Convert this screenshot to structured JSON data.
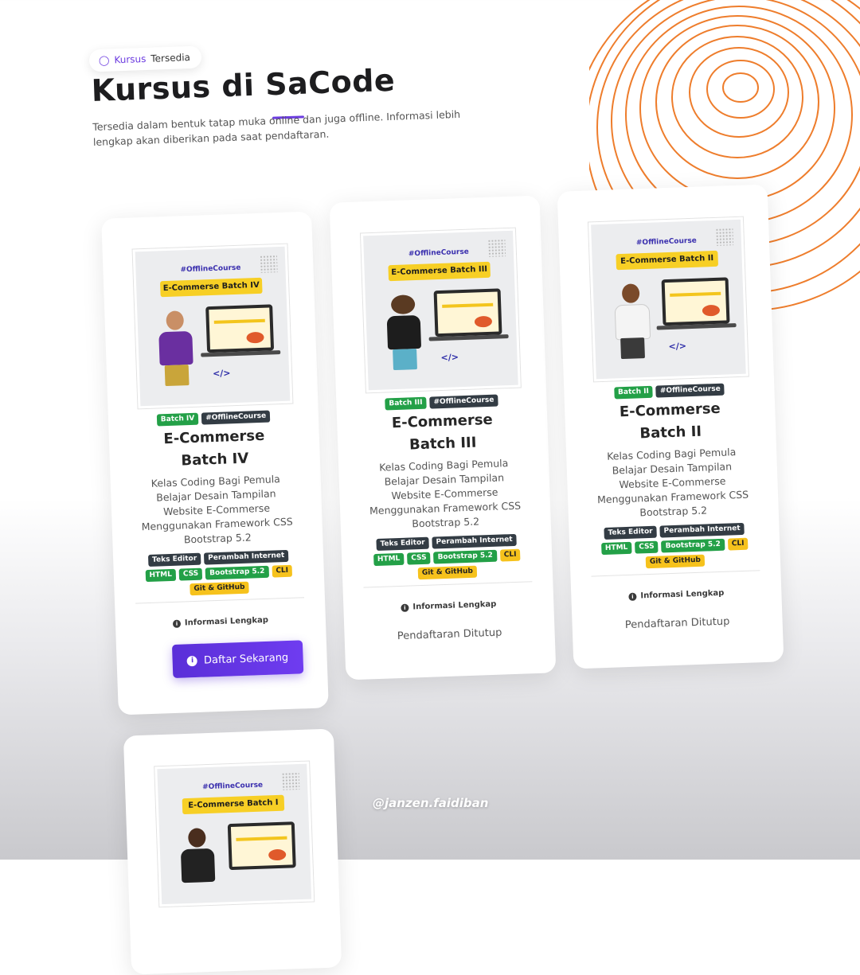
{
  "header": {
    "pill_word1": "Kursus",
    "pill_word2": "Tersedia",
    "title": "Kursus di SaCode",
    "description": "Tersedia dalam bentuk tatap muka online dan juga offline. Informasi lebih lengkap akan diberikan pada saat pendaftaran."
  },
  "courses": [
    {
      "thumb_tag": "#OfflineCourse",
      "thumb_banner": "E-Commerse Batch IV",
      "batch_badge": "Batch IV",
      "offline_badge": "#OfflineCourse",
      "title_line1": "E-Commerse",
      "title_line2": "Batch IV",
      "description": "Kelas Coding Bagi Pemula Belajar Desain Tampilan Website E-Commerse Menggunakan Framework CSS Bootstrap 5.2",
      "tools": [
        "Teks Editor",
        "Perambah Internet",
        "HTML",
        "CSS",
        "Bootstrap 5.2",
        "CLI",
        "Git & GitHub"
      ],
      "info_label": "Informasi Lengkap",
      "action_label": "Daftar Sekarang"
    },
    {
      "thumb_tag": "#OfflineCourse",
      "thumb_banner": "E-Commerse Batch III",
      "batch_badge": "Batch III",
      "offline_badge": "#OfflineCourse",
      "title_line1": "E-Commerse",
      "title_line2": "Batch III",
      "description": "Kelas Coding Bagi Pemula Belajar Desain Tampilan Website E-Commerse Menggunakan Framework CSS Bootstrap 5.2",
      "tools": [
        "Teks Editor",
        "Perambah Internet",
        "HTML",
        "CSS",
        "Bootstrap 5.2",
        "CLI",
        "Git & GitHub"
      ],
      "info_label": "Informasi Lengkap",
      "status_label": "Pendaftaran Ditutup"
    },
    {
      "thumb_tag": "#OfflineCourse",
      "thumb_banner": "E-Commerse Batch II",
      "batch_badge": "Batch II",
      "offline_badge": "#OfflineCourse",
      "title_line1": "E-Commerse",
      "title_line2": "Batch II",
      "description": "Kelas Coding Bagi Pemula Belajar Desain Tampilan Website E-Commerse Menggunakan Framework CSS Bootstrap 5.2",
      "tools": [
        "Teks Editor",
        "Perambah Internet",
        "HTML",
        "CSS",
        "Bootstrap 5.2",
        "CLI",
        "Git & GitHub"
      ],
      "info_label": "Informasi Lengkap",
      "status_label": "Pendaftaran Ditutup"
    },
    {
      "thumb_tag": "#OfflineCourse",
      "thumb_banner": "E-Commerse Batch I"
    }
  ],
  "watermark": "@janzen.faidiban",
  "colors": {
    "accent": "#6c3ce0",
    "badge_green": "#23a047",
    "badge_dark": "#333c44",
    "badge_yellow": "#f6c21c",
    "contour_orange": "#ee7d2c"
  }
}
